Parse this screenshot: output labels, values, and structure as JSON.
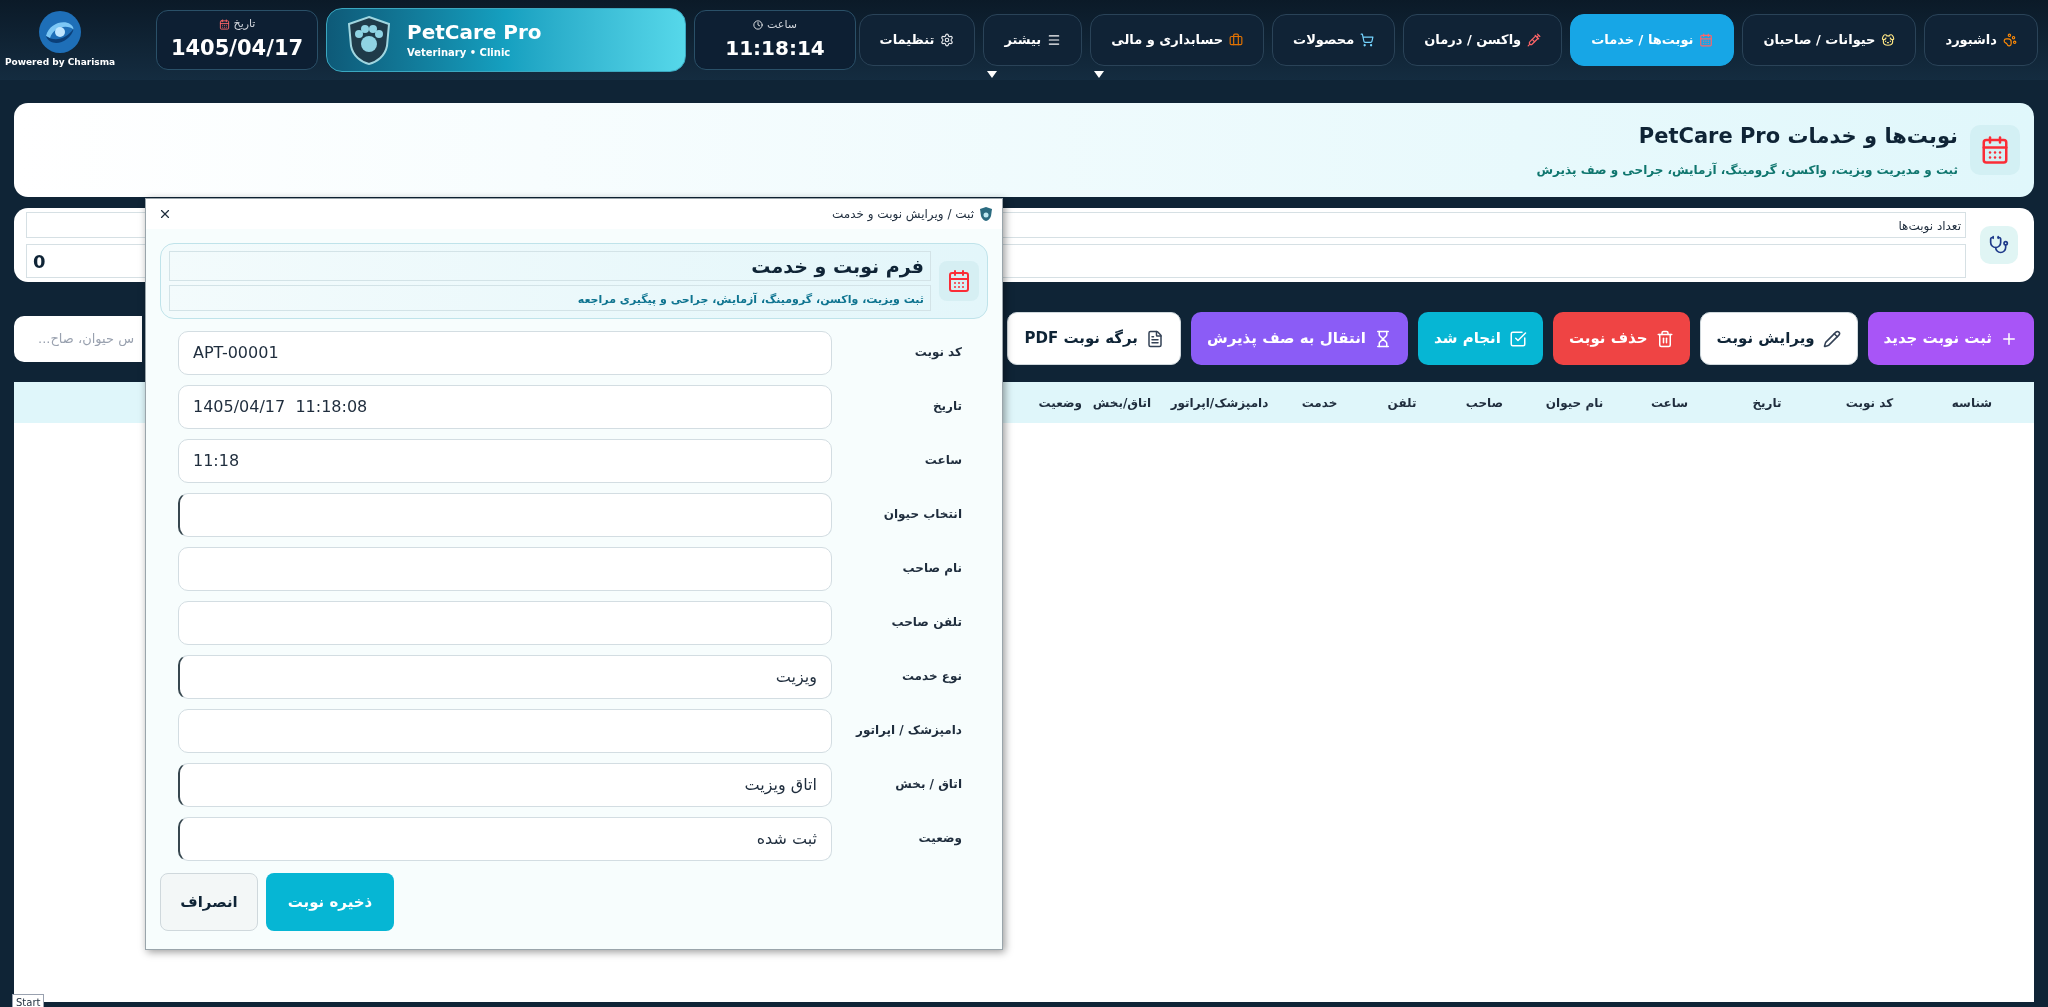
{
  "branding": {
    "powered_by": "Powered by Charisma",
    "date_label": "تاریخ",
    "date": "1405/04/17",
    "app_name": "PetCare Pro",
    "app_tagline": "Veterinary • Clinic",
    "time_label": "ساعت",
    "time": "11:18:14"
  },
  "nav": [
    {
      "label": "داشبورد",
      "selected": false,
      "dropdown": false
    },
    {
      "label": "حیوانات / صاحبان",
      "selected": false,
      "dropdown": false
    },
    {
      "label": "نوبت‌ها / خدمات",
      "selected": true,
      "dropdown": false
    },
    {
      "label": "واکسن / درمان",
      "selected": false,
      "dropdown": false
    },
    {
      "label": "محصولات",
      "selected": false,
      "dropdown": false
    },
    {
      "label": "حسابداری و مالی",
      "selected": false,
      "dropdown": true
    },
    {
      "label": "بیشتر",
      "selected": false,
      "dropdown": true
    },
    {
      "label": "تنظیمات",
      "selected": false,
      "dropdown": false
    }
  ],
  "page_header": {
    "title": "نوبت‌ها و خدمات PetCare Pro",
    "subtitle": "ثبت و مدیریت ویزیت، واکسن، گرومینگ، آزمایش، جراحی و صف پذیرش"
  },
  "summary": {
    "label": "تعداد نوبت‌ها",
    "value": "0"
  },
  "toolbar": [
    {
      "label": "ثبت نوبت جدید",
      "color": "#a855f7"
    },
    {
      "label": "ویرایش نوبت",
      "color": "#ffffff"
    },
    {
      "label": "حذف نوبت",
      "color": "#ef4444"
    },
    {
      "label": "انجام شد",
      "color": "#06b6d4"
    },
    {
      "label": "انتقال به صف پذیرش",
      "color": "#8b5cf6"
    },
    {
      "label": "برگه نوبت PDF",
      "color": "#ffffff"
    }
  ],
  "search": {
    "placeholder": "س حیوان، صاح..."
  },
  "table": {
    "columns": [
      "شناسه",
      "کد نوبت",
      "تاریخ",
      "ساعت",
      "نام حیوان",
      "صاحب",
      "تلفن",
      "خدمت",
      "دامپزشک/اپراتور",
      "اتاق/بخش",
      "وضعیت"
    ]
  },
  "dialog": {
    "title": "ثبت / ویرایش نوبت و خدمت",
    "form_title": "فرم نوبت و خدمت",
    "form_subtitle": "ثبت ویزیت، واکسن، گرومینگ، آزمایش، جراحی و پیگیری مراجعه",
    "fields": [
      {
        "label": "کد نوبت",
        "kind": "text",
        "value": "APT-00001"
      },
      {
        "label": "تاریخ",
        "kind": "text",
        "value": "1405/04/17  11:18:08"
      },
      {
        "label": "ساعت",
        "kind": "text",
        "value": "11:18"
      },
      {
        "label": "انتخاب حیوان",
        "kind": "combo"
      },
      {
        "label": "نام صاحب",
        "kind": "text"
      },
      {
        "label": "تلفن صاحب",
        "kind": "text"
      },
      {
        "label": "نوع خدمت",
        "kind": "combo",
        "value": "ویزیت"
      },
      {
        "label": "دامپزشک / اپراتور",
        "kind": "text"
      },
      {
        "label": "اتاق / بخش",
        "kind": "combo",
        "value": "اتاق ویزیت"
      },
      {
        "label": "وضعیت",
        "kind": "combo",
        "value": "ثبت شده"
      }
    ],
    "buttons": [
      {
        "label": "ذخیره نوبت",
        "kind": "primary"
      },
      {
        "label": "انصراف",
        "kind": "secondary"
      }
    ]
  },
  "tooltip": "Start"
}
